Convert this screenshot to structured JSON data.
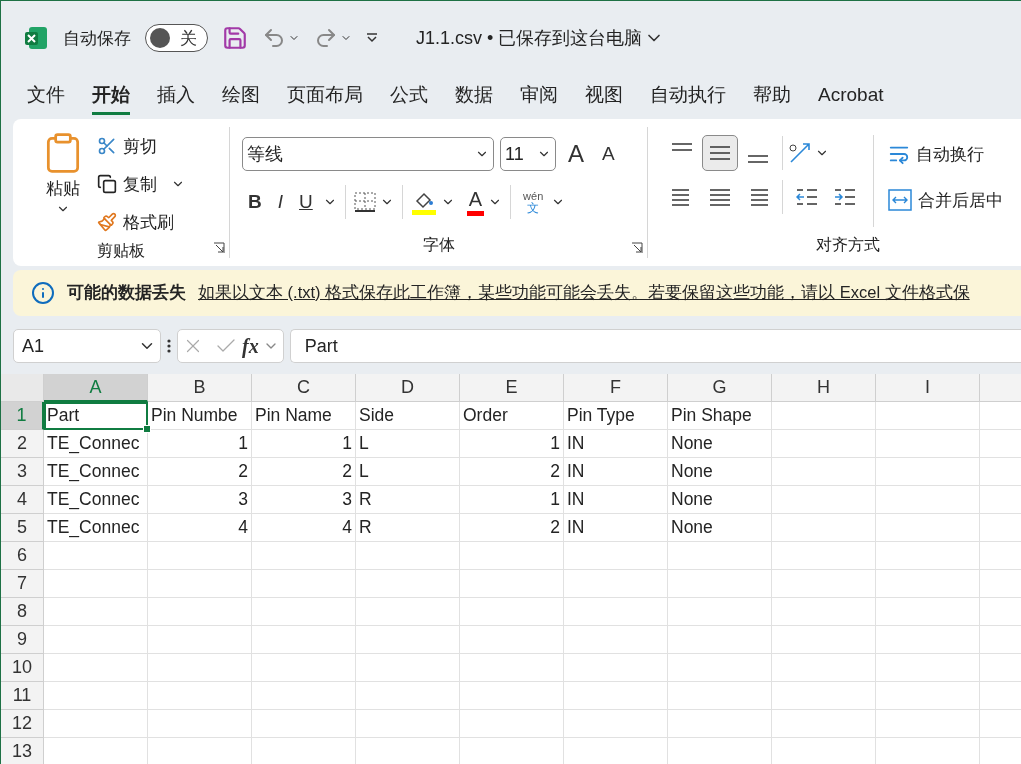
{
  "title_bar": {
    "autosave": {
      "label": "自动保存",
      "on": false,
      "state_label": "关"
    },
    "document_title": "J1.1.csv • 已保存到这台电脑"
  },
  "tabs": [
    {
      "label": "文件",
      "selected": false
    },
    {
      "label": "开始",
      "selected": true
    },
    {
      "label": "插入",
      "selected": false
    },
    {
      "label": "绘图",
      "selected": false
    },
    {
      "label": "页面布局",
      "selected": false
    },
    {
      "label": "公式",
      "selected": false
    },
    {
      "label": "数据",
      "selected": false
    },
    {
      "label": "审阅",
      "selected": false
    },
    {
      "label": "视图",
      "selected": false
    },
    {
      "label": "自动执行",
      "selected": false
    },
    {
      "label": "帮助",
      "selected": false
    },
    {
      "label": "Acrobat",
      "selected": false
    }
  ],
  "ribbon": {
    "clipboard": {
      "label": "剪贴板",
      "paste": "粘贴",
      "cut": "剪切",
      "copy": "复制",
      "format_painter": "格式刷"
    },
    "font": {
      "label": "字体",
      "font_name": "等线",
      "font_size": "11",
      "grow": "A",
      "shrink": "A",
      "bold": "B",
      "italic": "I",
      "underline": "U",
      "font_color": "A",
      "phonetic_top": "wén",
      "phonetic_bottom": "文"
    },
    "alignment": {
      "label": "对齐方式",
      "vertical": [
        {
          "kind": "top",
          "selected": false
        },
        {
          "kind": "middle",
          "selected": true
        },
        {
          "kind": "bottom",
          "selected": false
        }
      ],
      "wrap_text": "自动换行",
      "merge": "合并后居中"
    }
  },
  "info_bar": {
    "title": "可能的数据丢失",
    "message": "如果以文本 (.txt) 格式保存此工作簿，某些功能可能会丢失。若要保留这些功能，请以 Excel 文件格式保"
  },
  "formula_bar": {
    "name_box": "A1",
    "fx": "fx",
    "formula": "Part"
  },
  "sheet": {
    "columns": [
      {
        "label": "A",
        "selected": true
      },
      {
        "label": "B",
        "selected": false
      },
      {
        "label": "C",
        "selected": false
      },
      {
        "label": "D",
        "selected": false
      },
      {
        "label": "E",
        "selected": false
      },
      {
        "label": "F",
        "selected": false
      },
      {
        "label": "G",
        "selected": false
      },
      {
        "label": "H",
        "selected": false
      },
      {
        "label": "I",
        "selected": false
      }
    ],
    "rows": [
      {
        "number": "1",
        "selected": true,
        "cells": [
          {
            "text": "Part",
            "kind": "text"
          },
          {
            "text": "Pin Numbe",
            "kind": "text"
          },
          {
            "text": "Pin Name",
            "kind": "text"
          },
          {
            "text": "Side",
            "kind": "text"
          },
          {
            "text": "Order",
            "kind": "text"
          },
          {
            "text": "Pin Type",
            "kind": "text"
          },
          {
            "text": "Pin Shape",
            "kind": "text"
          }
        ]
      },
      {
        "number": "2",
        "selected": false,
        "cells": [
          {
            "text": "TE_Connec",
            "kind": "text"
          },
          {
            "text": "1",
            "kind": "number"
          },
          {
            "text": "1",
            "kind": "number"
          },
          {
            "text": "L",
            "kind": "text"
          },
          {
            "text": "1",
            "kind": "number"
          },
          {
            "text": "IN",
            "kind": "text"
          },
          {
            "text": "None",
            "kind": "text"
          }
        ]
      },
      {
        "number": "3",
        "selected": false,
        "cells": [
          {
            "text": "TE_Connec",
            "kind": "text"
          },
          {
            "text": "2",
            "kind": "number"
          },
          {
            "text": "2",
            "kind": "number"
          },
          {
            "text": "L",
            "kind": "text"
          },
          {
            "text": "2",
            "kind": "number"
          },
          {
            "text": "IN",
            "kind": "text"
          },
          {
            "text": "None",
            "kind": "text"
          }
        ]
      },
      {
        "number": "4",
        "selected": false,
        "cells": [
          {
            "text": "TE_Connec",
            "kind": "text"
          },
          {
            "text": "3",
            "kind": "number"
          },
          {
            "text": "3",
            "kind": "number"
          },
          {
            "text": "R",
            "kind": "text"
          },
          {
            "text": "1",
            "kind": "number"
          },
          {
            "text": "IN",
            "kind": "text"
          },
          {
            "text": "None",
            "kind": "text"
          }
        ]
      },
      {
        "number": "5",
        "selected": false,
        "cells": [
          {
            "text": "TE_Connec",
            "kind": "text"
          },
          {
            "text": "4",
            "kind": "number"
          },
          {
            "text": "4",
            "kind": "number"
          },
          {
            "text": "R",
            "kind": "text"
          },
          {
            "text": "2",
            "kind": "number"
          },
          {
            "text": "IN",
            "kind": "text"
          },
          {
            "text": "None",
            "kind": "text"
          }
        ]
      },
      {
        "number": "6",
        "selected": false
      },
      {
        "number": "7",
        "selected": false
      },
      {
        "number": "8",
        "selected": false
      },
      {
        "number": "9",
        "selected": false
      },
      {
        "number": "10",
        "selected": false
      },
      {
        "number": "11",
        "selected": false
      },
      {
        "number": "12",
        "selected": false
      },
      {
        "number": "13",
        "selected": false
      }
    ]
  }
}
